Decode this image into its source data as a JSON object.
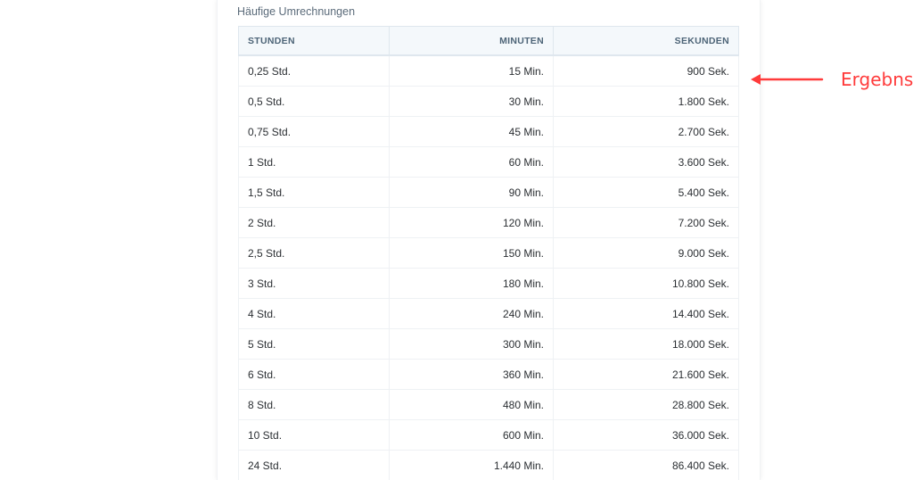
{
  "section": {
    "title": "Häufige Umrechnungen"
  },
  "table": {
    "headers": [
      "STUNDEN",
      "MINUTEN",
      "SEKUNDEN"
    ],
    "rows": [
      [
        "0,25 Std.",
        "15 Min.",
        "900 Sek."
      ],
      [
        "0,5 Std.",
        "30 Min.",
        "1.800 Sek."
      ],
      [
        "0,75 Std.",
        "45 Min.",
        "2.700 Sek."
      ],
      [
        "1 Std.",
        "60 Min.",
        "3.600 Sek."
      ],
      [
        "1,5 Std.",
        "90 Min.",
        "5.400 Sek."
      ],
      [
        "2 Std.",
        "120 Min.",
        "7.200 Sek."
      ],
      [
        "2,5 Std.",
        "150 Min.",
        "9.000 Sek."
      ],
      [
        "3 Std.",
        "180 Min.",
        "10.800 Sek."
      ],
      [
        "4 Std.",
        "240 Min.",
        "14.400 Sek."
      ],
      [
        "5 Std.",
        "300 Min.",
        "18.000 Sek."
      ],
      [
        "6 Std.",
        "360 Min.",
        "21.600 Sek."
      ],
      [
        "8 Std.",
        "480 Min.",
        "28.800 Sek."
      ],
      [
        "10 Std.",
        "600 Min.",
        "36.000 Sek."
      ],
      [
        "24 Std.",
        "1.440 Min.",
        "86.400 Sek."
      ]
    ]
  },
  "annotation": {
    "label": "Ergebns",
    "icon": "arrow-left-icon",
    "color": "#ff3b3b"
  },
  "colors": {
    "header_bg": "#f4f8fb",
    "header_text": "#4d6477",
    "title_text": "#5b6b7a"
  }
}
